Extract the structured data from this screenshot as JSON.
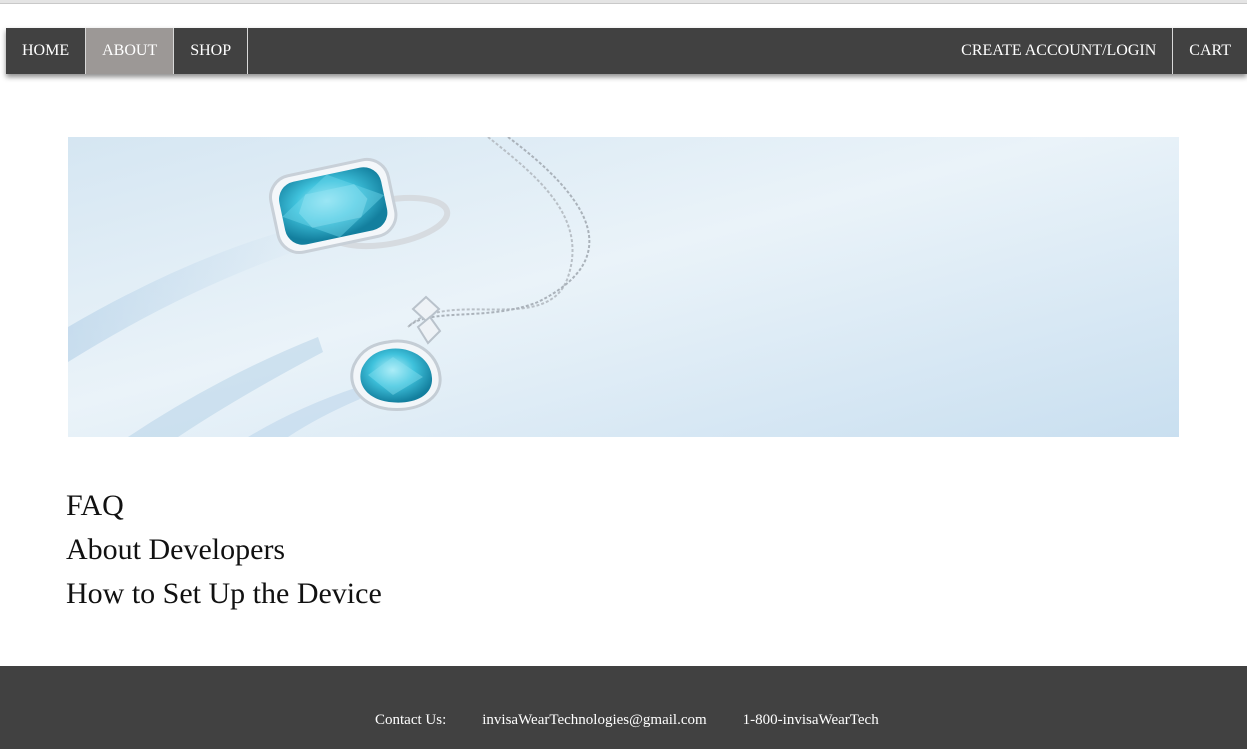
{
  "nav": {
    "left": [
      {
        "label": "HOME",
        "name": "nav-home",
        "active": false
      },
      {
        "label": "ABOUT",
        "name": "nav-about",
        "active": true
      },
      {
        "label": "SHOP",
        "name": "nav-shop",
        "active": false
      }
    ],
    "right": [
      {
        "label": "CREATE ACCOUNT/LOGIN",
        "name": "nav-create-account-login"
      },
      {
        "label": "CART",
        "name": "nav-cart"
      }
    ],
    "bg_color": "#414141",
    "active_color": "#9c9896"
  },
  "hero": {
    "image": "jewelry-banner (aquamarine ring and pendant necklace)"
  },
  "links": [
    {
      "label": "FAQ",
      "name": "faq-link"
    },
    {
      "label": "About Developers",
      "name": "about-developers-link"
    },
    {
      "label": "How to Set Up the Device",
      "name": "setup-device-link"
    }
  ],
  "footer": {
    "contact_label": "Contact Us:",
    "email": "invisaWearTechnologies@gmail.com",
    "phone": "1-800-invisaWearTech",
    "bg_color": "#414141"
  }
}
